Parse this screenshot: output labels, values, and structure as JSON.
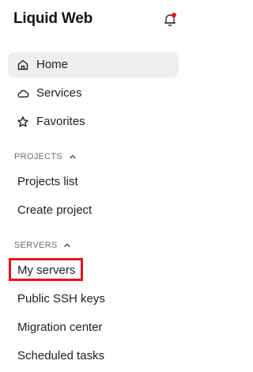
{
  "header": {
    "logo_text": "Liquid Web",
    "notification_dot_color": "#e0202a"
  },
  "nav": {
    "items": [
      {
        "label": "Home",
        "icon": "home-icon",
        "active": true
      },
      {
        "label": "Services",
        "icon": "cloud-icon",
        "active": false
      },
      {
        "label": "Favorites",
        "icon": "star-icon",
        "active": false
      }
    ]
  },
  "sections": {
    "projects": {
      "title": "PROJECTS",
      "expanded": true,
      "items": [
        "Projects list",
        "Create project"
      ]
    },
    "servers": {
      "title": "SERVERS",
      "expanded": true,
      "items": [
        "My servers",
        "Public SSH keys",
        "Migration center",
        "Scheduled tasks"
      ]
    }
  },
  "highlight": {
    "target": "My servers",
    "color": "#e8101c"
  }
}
